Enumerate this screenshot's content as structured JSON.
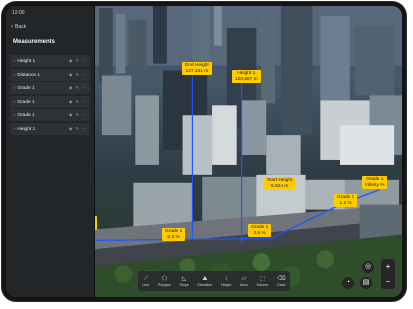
{
  "panel": {
    "status_time": "12:00",
    "back_label": "Back",
    "title": "Measurements",
    "items": [
      {
        "label": "Height 1"
      },
      {
        "label": "Distance 1"
      },
      {
        "label": "Grade 1"
      },
      {
        "label": "Grade 1"
      },
      {
        "label": "Grade 1"
      },
      {
        "label": "Height 1"
      }
    ]
  },
  "measurements": {
    "end_height": {
      "line1": "End Height",
      "line2": "127.331 m"
    },
    "height1": {
      "line1": "Height 1",
      "line2": "120.667 m"
    },
    "start_height": {
      "line1": "Start Height",
      "line2": "6.624 m"
    },
    "grade_a": {
      "line1": "Grade 1",
      "line2": "1.2 %"
    },
    "grade_b": {
      "line1": "Grade 1",
      "line2": "Infinity %"
    },
    "grade_c": {
      "line1": "Grade 1",
      "line2": "0.3 %"
    },
    "grade_d": {
      "line1": "Grade 1",
      "line2": "2.6 %"
    }
  },
  "toolbar": {
    "tools": [
      {
        "label": "Line",
        "icon": "line-icon"
      },
      {
        "label": "Polygon",
        "icon": "polygon-icon"
      },
      {
        "label": "Slope",
        "icon": "slope-icon"
      },
      {
        "label": "Elevation",
        "icon": "elevation-icon"
      },
      {
        "label": "Height",
        "icon": "height-icon"
      },
      {
        "label": "Area",
        "icon": "area-icon"
      },
      {
        "label": "Volume",
        "icon": "volume-icon"
      },
      {
        "label": "Clear",
        "icon": "clear-icon"
      }
    ]
  },
  "colors": {
    "label_bg": "#ffcc00",
    "panel_bg": "#232629",
    "measure_line": "#2255ff"
  }
}
